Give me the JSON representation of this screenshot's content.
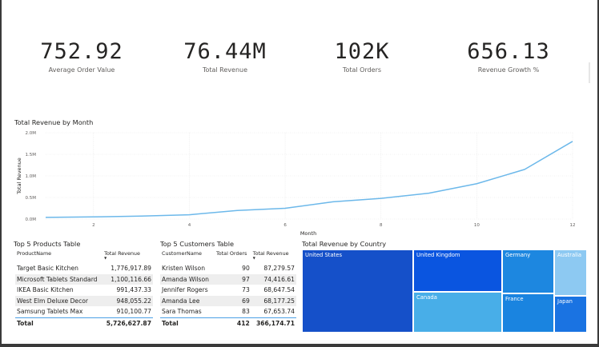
{
  "kpis": [
    {
      "value": "752.92",
      "label": "Average Order Value"
    },
    {
      "value": "76.44M",
      "label": "Total Revenue"
    },
    {
      "value": "102K",
      "label": "Total Orders"
    },
    {
      "value": "656.13",
      "label": "Revenue Growth %"
    }
  ],
  "line_chart": {
    "title": "Total Revenue by Month"
  },
  "chart_data": {
    "type": "line",
    "title": "Total Revenue by Month",
    "xlabel": "Month",
    "ylabel": "Total Revenue",
    "x": [
      1,
      2,
      3,
      4,
      5,
      6,
      7,
      8,
      9,
      10,
      11,
      12
    ],
    "series": [
      {
        "values": [
          0.04,
          0.05,
          0.07,
          0.1,
          0.2,
          0.25,
          0.4,
          0.48,
          0.6,
          0.82,
          1.15,
          1.8
        ]
      }
    ],
    "xlim": [
      1,
      12
    ],
    "ylim": [
      0,
      2.0
    ],
    "x_ticks": [
      "2",
      "4",
      "6",
      "8",
      "10",
      "12"
    ],
    "x_tick_values": [
      2,
      4,
      6,
      8,
      10,
      12
    ],
    "y_ticks": [
      "0.0M",
      "0.5M",
      "1.0M",
      "1.5M",
      "2.0M"
    ],
    "y_tick_values": [
      0,
      0.5,
      1.0,
      1.5,
      2.0
    ],
    "grid": true,
    "color": "#6cb8ea"
  },
  "products_table": {
    "title": "Top 5 Products Table",
    "columns": [
      "ProductName",
      "Total Revenue"
    ],
    "rows": [
      [
        "Target Basic Kitchen",
        "1,776,917.89"
      ],
      [
        "Microsoft Tablets Standard",
        "1,100,116.66"
      ],
      [
        "IKEA Basic Kitchen",
        "991,437.33"
      ],
      [
        "West Elm Deluxe Decor",
        "948,055.22"
      ],
      [
        "Samsung Tablets Max",
        "910,100.77"
      ]
    ],
    "total": [
      "Total",
      "5,726,627.87"
    ]
  },
  "customers_table": {
    "title": "Top 5 Customers Table",
    "columns": [
      "CustomerName",
      "Total Orders",
      "Total Revenue"
    ],
    "rows": [
      [
        "Kristen Wilson",
        "90",
        "87,279.57"
      ],
      [
        "Amanda Wilson",
        "97",
        "74,416.61"
      ],
      [
        "Jennifer Rogers",
        "73",
        "68,647.54"
      ],
      [
        "Amanda Lee",
        "69",
        "68,177.25"
      ],
      [
        "Sara Thomas",
        "83",
        "67,653.74"
      ]
    ],
    "total": [
      "Total",
      "412",
      "366,174.71"
    ]
  },
  "treemap": {
    "title": "Total Revenue by Country",
    "tiles": [
      {
        "label": "United States",
        "color": "#1550c9"
      },
      {
        "label": "United Kingdom",
        "color": "#0a55e0"
      },
      {
        "label": "Canada",
        "color": "#48aee8"
      },
      {
        "label": "Germany",
        "color": "#1d87e0"
      },
      {
        "label": "France",
        "color": "#1a84e0"
      },
      {
        "label": "Australia",
        "color": "#8dc9f2"
      },
      {
        "label": "Japan",
        "color": "#1a73e2"
      }
    ]
  }
}
